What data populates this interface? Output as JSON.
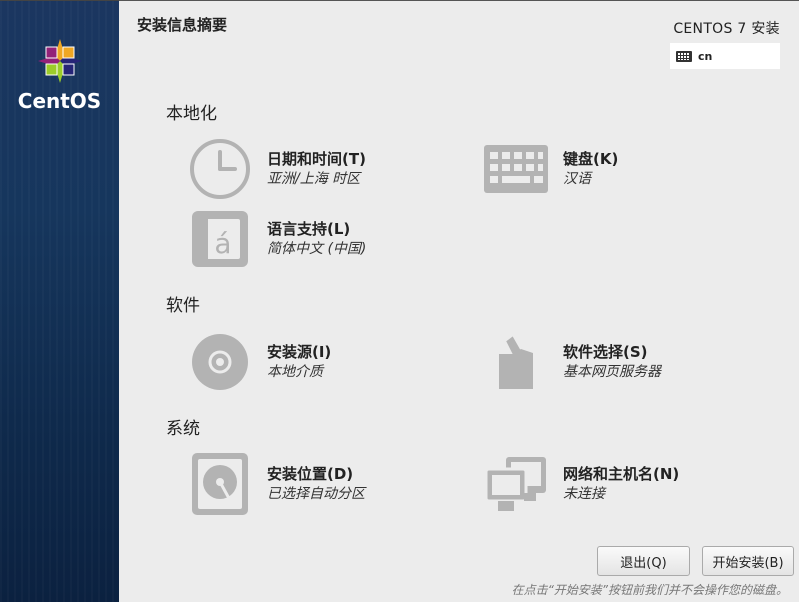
{
  "sidebar": {
    "brand": "CentOS"
  },
  "header": {
    "title": "安装信息摘要",
    "product": "CENTOS 7 安装",
    "keyboard_layout": "cn"
  },
  "sections": {
    "localization": "本地化",
    "software": "软件",
    "system": "系统"
  },
  "spokes": {
    "datetime": {
      "name": "日期和时间(T)",
      "status": "亚洲/上海 时区"
    },
    "keyboard": {
      "name": "键盘(K)",
      "status": "汉语"
    },
    "language": {
      "name": "语言支持(L)",
      "status": "简体中文 (中国)"
    },
    "source": {
      "name": "安装源(I)",
      "status": "本地介质"
    },
    "software_selection": {
      "name": "软件选择(S)",
      "status": "基本网页服务器"
    },
    "destination": {
      "name": "安装位置(D)",
      "status": "已选择自动分区"
    },
    "network": {
      "name": "网络和主机名(N)",
      "status": "未连接"
    }
  },
  "buttons": {
    "quit": "退出(Q)",
    "begin": "开始安装(B)"
  },
  "footnote": "在点击“开始安装”按钮前我们并不会操作您的磁盘。",
  "colors": {
    "icon_gray": "#b3b3b3",
    "sidebar_blue": "#16365d",
    "panel_bg": "#ececec"
  }
}
